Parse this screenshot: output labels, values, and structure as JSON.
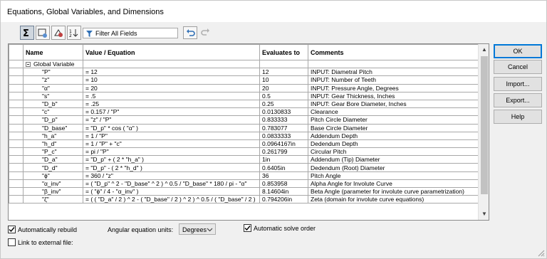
{
  "window": {
    "title": "Equations, Global Variables, and Dimensions"
  },
  "toolbar": {
    "buttons": [
      "equation-view-icon",
      "sketch-equation-view-icon",
      "dimension-view-icon",
      "ordered-view-icon"
    ],
    "filter_placeholder": "Filter All Fields"
  },
  "grid": {
    "headers": {
      "name": "Name",
      "value": "Value / Equation",
      "evaluates": "Evaluates to",
      "comments": "Comments"
    },
    "group_label": "Global Variable",
    "rows": [
      {
        "name": "\"P\"",
        "value": "= 12",
        "evaluates": "12",
        "comments": "INPUT: Diametral Pitch"
      },
      {
        "name": "\"z\"",
        "value": "= 10",
        "evaluates": "10",
        "comments": "INPUT: Number of Teeth"
      },
      {
        "name": "\"α\"",
        "value": "= 20",
        "evaluates": "20",
        "comments": "INPUT: Pressure Angle, Degrees"
      },
      {
        "name": "\"s\"",
        "value": "= .5",
        "evaluates": "0.5",
        "comments": "INPUT: Gear Thickness, Inches"
      },
      {
        "name": "\"D_b\"",
        "value": "= .25",
        "evaluates": "0.25",
        "comments": "INPUT: Gear Bore Diameter, Inches"
      },
      {
        "name": "\"c\"",
        "value": "= 0.157 / \"P\"",
        "evaluates": "0.0130833",
        "comments": "Clearance"
      },
      {
        "name": "\"D_p\"",
        "value": "= \"z\" / \"P\"",
        "evaluates": "0.833333",
        "comments": "Pitch Circle Diameter"
      },
      {
        "name": "\"D_base\"",
        "value": "= \"D_p\" * cos ( \"α\" )",
        "evaluates": "0.783077",
        "comments": "Base Circle Diameter"
      },
      {
        "name": "\"h_a\"",
        "value": "= 1 / \"P\"",
        "evaluates": "0.0833333",
        "comments": "Addendum Depth"
      },
      {
        "name": "\"h_d\"",
        "value": "= 1 / \"P\" + \"c\"",
        "evaluates": "0.0964167in",
        "comments": "Dedendum Depth"
      },
      {
        "name": "\"P_c\"",
        "value": "= pi / \"P\"",
        "evaluates": "0.261799",
        "comments": "Circular Pitch"
      },
      {
        "name": "\"D_a\"",
        "value": "= \"D_p\" + ( 2 * \"h_a\" )",
        "evaluates": "1in",
        "comments": "Addendum (Tip) Diameter"
      },
      {
        "name": "\"D_d\"",
        "value": "= \"D_p\" - ( 2 * \"h_d\" )",
        "evaluates": "0.6405in",
        "comments": "Dedendum (Root) Diameter"
      },
      {
        "name": "\"ϕ\"",
        "value": "= 360 / \"z\"",
        "evaluates": "36",
        "comments": "Pitch Angle"
      },
      {
        "name": "\"α_inv\"",
        "value": "= ( \"D_p\" ^ 2 - \"D_base\" ^ 2 ) ^ 0.5 / \"D_base\" * 180 / pi - \"α\"",
        "evaluates": "0.853958",
        "comments": "Alpha Angle for Involute Curve"
      },
      {
        "name": "\"β_inv\"",
        "value": "= ( \"ϕ\" / 4 - \"α_inv\" )",
        "evaluates": "8.14604in",
        "comments": "Beta Angle (parameter for involute curve parametrization)"
      },
      {
        "name": "\"ζ\"",
        "value": "= ( ( \"D_a\" / 2 ) ^ 2 - ( \"D_base\" / 2 ) ^ 2 ) ^ 0.5 / ( \"D_base\" / 2 )",
        "evaluates": "0.794206in",
        "comments": "Zeta (domain for involute curve equations)"
      }
    ]
  },
  "buttons": {
    "ok": "OK",
    "cancel": "Cancel",
    "import": "Import...",
    "export": "Export...",
    "help": "Help"
  },
  "options": {
    "auto_rebuild": {
      "label": "Automatically rebuild",
      "checked": true
    },
    "angular_units_label": "Angular equation units:",
    "angular_units_value": "Degrees",
    "auto_solve": {
      "label": "Automatic solve order",
      "checked": true
    },
    "link_external": {
      "label": "Link to external file:",
      "checked": false
    }
  }
}
